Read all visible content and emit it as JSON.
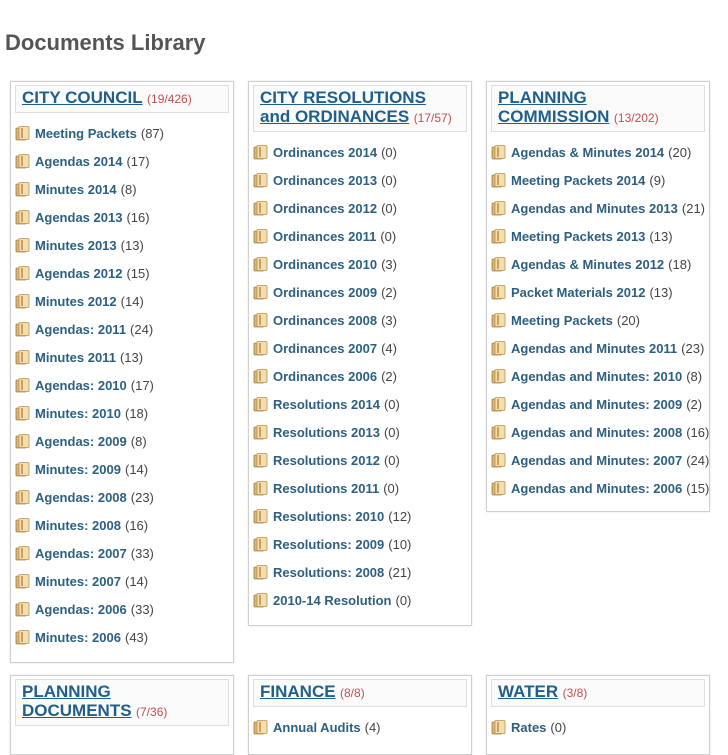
{
  "page": {
    "title": "Documents Library"
  },
  "icons": {
    "folder": "folder-icon"
  },
  "colors": {
    "link": "#2d5f80",
    "title": "#1f5f8b",
    "count_accent": "#c0504d"
  },
  "panels": [
    {
      "id": "city-council",
      "title": "CITY COUNCIL",
      "count": "(19/426)",
      "items": [
        {
          "label": "Meeting Packets",
          "count": "(87)"
        },
        {
          "label": "Agendas 2014",
          "count": "(17)"
        },
        {
          "label": "Minutes 2014",
          "count": "(8)"
        },
        {
          "label": "Agendas 2013",
          "count": "(16)"
        },
        {
          "label": "Minutes 2013",
          "count": "(13)"
        },
        {
          "label": "Agendas 2012",
          "count": "(15)"
        },
        {
          "label": "Minutes 2012",
          "count": "(14)"
        },
        {
          "label": "Agendas: 2011",
          "count": "(24)"
        },
        {
          "label": "Minutes 2011",
          "count": "(13)"
        },
        {
          "label": "Agendas: 2010",
          "count": "(17)"
        },
        {
          "label": "Minutes: 2010",
          "count": "(18)"
        },
        {
          "label": "Agendas: 2009",
          "count": "(8)"
        },
        {
          "label": "Minutes: 2009",
          "count": "(14)"
        },
        {
          "label": "Agendas: 2008",
          "count": "(23)"
        },
        {
          "label": "Minutes: 2008",
          "count": "(16)"
        },
        {
          "label": "Agendas: 2007",
          "count": "(33)"
        },
        {
          "label": "Minutes: 2007",
          "count": "(14)"
        },
        {
          "label": "Agendas: 2006",
          "count": "(33)"
        },
        {
          "label": "Minutes: 2006",
          "count": "(43)"
        }
      ]
    },
    {
      "id": "city-resolutions",
      "title": "CITY RESOLUTIONS and ORDINANCES",
      "count": "(17/57)",
      "items": [
        {
          "label": "Ordinances 2014",
          "count": "(0)"
        },
        {
          "label": "Ordinances 2013",
          "count": "(0)"
        },
        {
          "label": "Ordinances 2012",
          "count": "(0)"
        },
        {
          "label": "Ordinances 2011",
          "count": "(0)"
        },
        {
          "label": "Ordinances 2010",
          "count": "(3)"
        },
        {
          "label": "Ordinances 2009",
          "count": "(2)"
        },
        {
          "label": "Ordinances 2008",
          "count": "(3)"
        },
        {
          "label": "Ordinances 2007",
          "count": "(4)"
        },
        {
          "label": "Ordinances 2006",
          "count": "(2)"
        },
        {
          "label": "Resolutions 2014",
          "count": "(0)"
        },
        {
          "label": "Resolutions 2013",
          "count": "(0)"
        },
        {
          "label": "Resolutions 2012",
          "count": "(0)"
        },
        {
          "label": "Resolutions 2011",
          "count": "(0)"
        },
        {
          "label": "Resolutions: 2010",
          "count": "(12)"
        },
        {
          "label": "Resolutions: 2009",
          "count": "(10)"
        },
        {
          "label": "Resolutions: 2008",
          "count": "(21)"
        },
        {
          "label": "2010-14 Resolution",
          "count": "(0)"
        }
      ]
    },
    {
      "id": "planning-commission",
      "title": "PLANNING COMMISSION",
      "count": "(13/202)",
      "items": [
        {
          "label": "Agendas & Minutes 2014",
          "count": "(20)"
        },
        {
          "label": "Meeting Packets 2014",
          "count": "(9)"
        },
        {
          "label": "Agendas and Minutes 2013",
          "count": "(21)"
        },
        {
          "label": "Meeting Packets 2013",
          "count": "(13)"
        },
        {
          "label": "Agendas & Minutes 2012",
          "count": "(18)"
        },
        {
          "label": "Packet Materials 2012",
          "count": "(13)"
        },
        {
          "label": "Meeting Packets",
          "count": "(20)"
        },
        {
          "label": "Agendas and Minutes 2011",
          "count": "(23)"
        },
        {
          "label": "Agendas and Minutes: 2010",
          "count": "(8)"
        },
        {
          "label": "Agendas and Minutes: 2009",
          "count": "(2)"
        },
        {
          "label": "Agendas and Minutes: 2008",
          "count": "(16)"
        },
        {
          "label": "Agendas and Minutes: 2007",
          "count": "(24)"
        },
        {
          "label": "Agendas and Minutes: 2006",
          "count": "(15)"
        }
      ]
    },
    {
      "id": "planning-documents",
      "title": "PLANNING DOCUMENTS",
      "count": "(7/36)",
      "items": []
    },
    {
      "id": "finance",
      "title": "FINANCE",
      "count": "(8/8)",
      "items": [
        {
          "label": "Annual Audits",
          "count": "(4)"
        }
      ]
    },
    {
      "id": "water",
      "title": "WATER",
      "count": "(3/8)",
      "items": [
        {
          "label": "Rates",
          "count": "(0)"
        }
      ]
    }
  ]
}
